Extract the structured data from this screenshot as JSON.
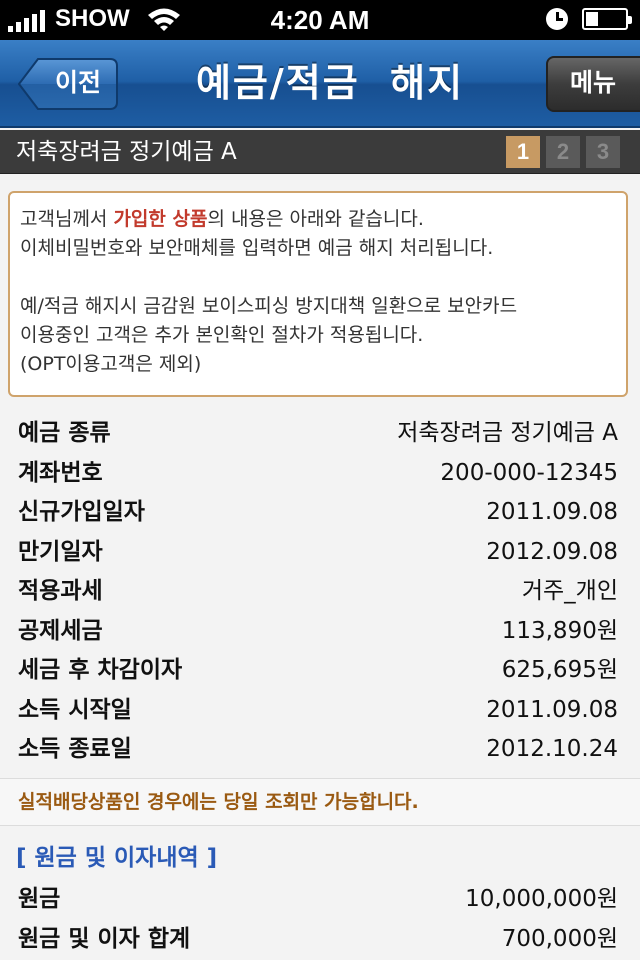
{
  "status_bar": {
    "carrier": "SHOW",
    "time": "4:20 AM",
    "icons": [
      "signal-icon",
      "wifi-icon",
      "clock-icon",
      "battery-icon"
    ]
  },
  "nav": {
    "back_label": "이전",
    "title": "예금/적금  해지",
    "menu_label": "메뉴"
  },
  "sub_header": {
    "product_name": "저축장려금 정기예금 A",
    "steps": [
      "1",
      "2",
      "3"
    ],
    "active_step": "1"
  },
  "notice": {
    "line1_prefix": "고객님께서 ",
    "line1_highlight": "가입한 상품",
    "line1_suffix": "의 내용은 아래와 같습니다.",
    "line2": "이체비밀번호와 보안매체를 입력하면 예금 해지 처리됩니다.",
    "line3": "예/적금 해지시 금감원 보이스피싱 방지대책 일환으로 보안카드",
    "line4": "이용중인 고객은 추가 본인확인 절차가 적용됩니다.",
    "line5": "(OPT이용고객은 제외)"
  },
  "details": [
    {
      "label": "예금 종류",
      "value": "저축장려금 정기예금 A"
    },
    {
      "label": "계좌번호",
      "value": "200-000-12345"
    },
    {
      "label": "신규가입일자",
      "value": "2011.09.08"
    },
    {
      "label": "만기일자",
      "value": "2012.09.08"
    },
    {
      "label": "적용과세",
      "value": "거주_개인"
    },
    {
      "label": "공제세금",
      "value": "113,890원"
    },
    {
      "label": "세금 후 차감이자",
      "value": "625,695원"
    },
    {
      "label": "소득 시작일",
      "value": "2011.09.08"
    },
    {
      "label": "소득 종료일",
      "value": "2012.10.24"
    }
  ],
  "caution_text": "실적배당상품인 경우에는 당일 조회만 가능합니다.",
  "principal_section": {
    "title": "[ 원금 및 이자내역 ]",
    "rows": [
      {
        "label": "원금",
        "value": "10,000,000원"
      },
      {
        "label": "원금 및 이자 합계",
        "value": "700,000원"
      }
    ]
  },
  "colors": {
    "nav_blue": "#1f5fa6",
    "accent_gold": "#c79a63",
    "highlight_red": "#c23a2c",
    "section_blue": "#2a5ab6",
    "caution_brown": "#9a5a12"
  }
}
